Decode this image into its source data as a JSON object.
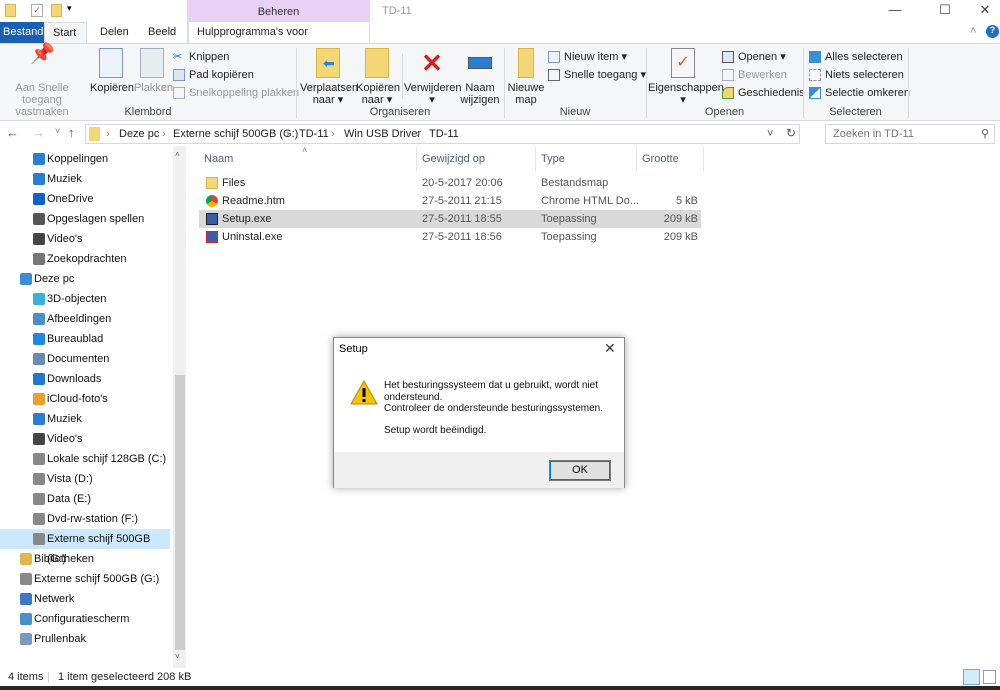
{
  "window": {
    "title": "TD-11",
    "context_tab": "Beheren"
  },
  "tabs": [
    "Bestand",
    "Start",
    "Delen",
    "Beeld",
    "Hulpprogramma's voor toepassingen"
  ],
  "ribbon": {
    "klembord": {
      "label": "Klembord",
      "pin": "Aan Snelle toegang vastmaken",
      "copy": "Kopiëren",
      "paste": "Plakken",
      "cut": "Knippen",
      "copy_path": "Pad kopiëren",
      "paste_shortcut": "Snelkoppeling plakken"
    },
    "organiseren": {
      "label": "Organiseren",
      "move": "Verplaatsen naar",
      "copy_to": "Kopiëren naar",
      "delete": "Verwijderen",
      "rename": "Naam wijzigen"
    },
    "nieuw": {
      "label": "Nieuw",
      "new_folder": "Nieuwe map",
      "new_item": "Nieuw item",
      "easy_access": "Snelle toegang"
    },
    "openen": {
      "label": "Openen",
      "properties": "Eigenschappen",
      "open": "Openen",
      "edit": "Bewerken",
      "history": "Geschiedenis"
    },
    "selecteren": {
      "label": "Selecteren",
      "all": "Alles selecteren",
      "none": "Niets selecteren",
      "invert": "Selectie omkeren"
    }
  },
  "address": {
    "crumbs": [
      "Deze pc",
      "Externe schijf 500GB (G:)",
      "TD-11",
      "Win USB Driver",
      "TD-11"
    ],
    "search_placeholder": "Zoeken in TD-11"
  },
  "sidebar": [
    {
      "label": "Koppelingen",
      "color": "#2b7cd3",
      "indent": 1
    },
    {
      "label": "Muziek",
      "color": "#2b7cd3",
      "indent": 1
    },
    {
      "label": "OneDrive",
      "color": "#0a64c8",
      "indent": 1
    },
    {
      "label": "Opgeslagen spellen",
      "color": "#555",
      "indent": 1
    },
    {
      "label": "Video's",
      "color": "#444",
      "indent": 1
    },
    {
      "label": "Zoekopdrachten",
      "color": "#777",
      "indent": 1
    },
    {
      "label": "Deze pc",
      "color": "#3a8fd8",
      "indent": 0
    },
    {
      "label": "3D-objecten",
      "color": "#3bb0d8",
      "indent": 1
    },
    {
      "label": "Afbeeldingen",
      "color": "#4a90c8",
      "indent": 1
    },
    {
      "label": "Bureaublad",
      "color": "#1e88e5",
      "indent": 1
    },
    {
      "label": "Documenten",
      "color": "#6a8bb0",
      "indent": 1
    },
    {
      "label": "Downloads",
      "color": "#1e78d0",
      "indent": 1
    },
    {
      "label": "iCloud-foto's",
      "color": "#e8a030",
      "indent": 1
    },
    {
      "label": "Muziek",
      "color": "#2b7cd3",
      "indent": 1
    },
    {
      "label": "Video's",
      "color": "#444",
      "indent": 1
    },
    {
      "label": "Lokale schijf 128GB (C:)",
      "color": "#888",
      "indent": 1
    },
    {
      "label": "Vista (D:)",
      "color": "#888",
      "indent": 1
    },
    {
      "label": "Data (E:)",
      "color": "#888",
      "indent": 1
    },
    {
      "label": "Dvd-rw-station (F:)",
      "color": "#888",
      "indent": 1
    },
    {
      "label": "Externe schijf 500GB (G:)",
      "color": "#888",
      "indent": 1,
      "selected": true
    },
    {
      "label": "Bibliotheken",
      "color": "#e0b84a",
      "indent": 0
    },
    {
      "label": "Externe schijf 500GB (G:)",
      "color": "#888",
      "indent": 0
    },
    {
      "label": "Netwerk",
      "color": "#3a78c8",
      "indent": 0
    },
    {
      "label": "Configuratiescherm",
      "color": "#4a90c8",
      "indent": 0
    },
    {
      "label": "Prullenbak",
      "color": "#7a9ac0",
      "indent": 0
    }
  ],
  "columns": [
    "Naam",
    "Gewijzigd op",
    "Type",
    "Grootte"
  ],
  "files": [
    {
      "name": "Files",
      "date": "20-5-2017 20:06",
      "type": "Bestandsmap",
      "size": "",
      "icon": "folder"
    },
    {
      "name": "Readme.htm",
      "date": "27-5-2011 21:15",
      "type": "Chrome HTML Do...",
      "size": "5 kB",
      "icon": "chrome"
    },
    {
      "name": "Setup.exe",
      "date": "27-5-2011 18:55",
      "type": "Toepassing",
      "size": "209 kB",
      "icon": "setup",
      "selected": true
    },
    {
      "name": "Uninstal.exe",
      "date": "27-5-2011 18:56",
      "type": "Toepassing",
      "size": "209 kB",
      "icon": "uninstall"
    }
  ],
  "status": {
    "count": "4 items",
    "selection": "1 item geselecteerd  208 kB"
  },
  "dialog": {
    "title": "Setup",
    "line1": "Het besturingssysteem dat u gebruikt, wordt niet",
    "line2": "ondersteund.",
    "line3": "Controleer de ondersteunde besturingssystemen.",
    "line4": "Setup wordt beëindigd.",
    "ok": "OK"
  }
}
